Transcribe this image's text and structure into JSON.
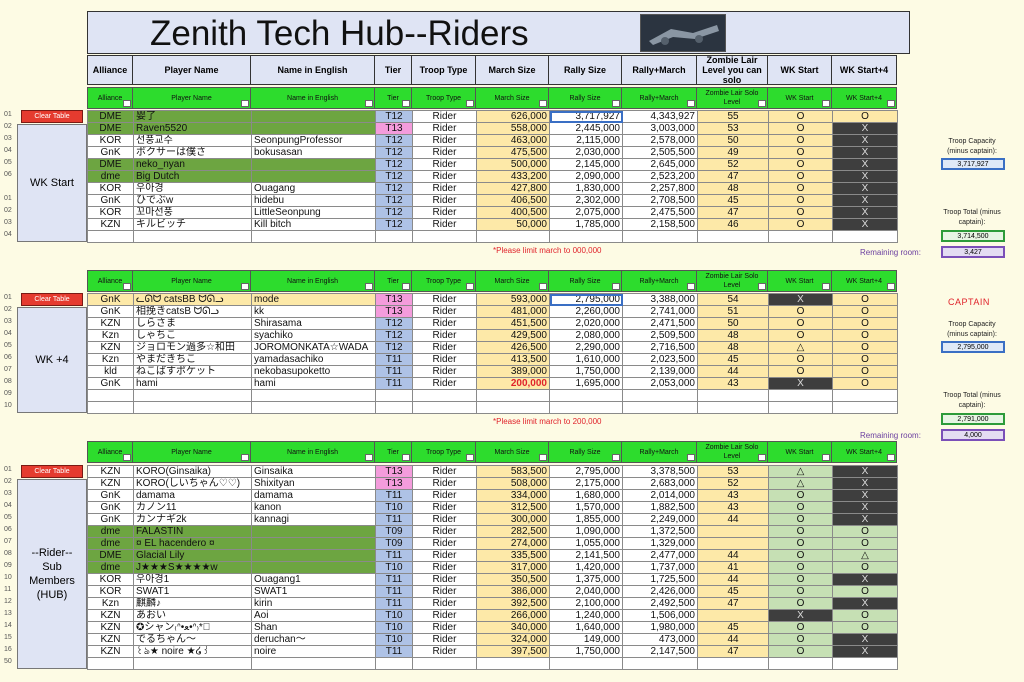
{
  "title": "Zenith Tech Hub--Riders",
  "top_headers": [
    "Alliance",
    "Player Name",
    "Name in English",
    "Tier",
    "Troop Type",
    "March Size",
    "Rally Size",
    "Rally+March",
    "Zombie Lair Level you can solo",
    "WK Start",
    "WK Start+4"
  ],
  "filter_headers": [
    "Alliance",
    "Player Name",
    "Name in English",
    "Tier",
    "Troop Type",
    "March Size",
    "Rally Size",
    "Rally+March",
    "Zombie Lair Solo Level",
    "WK Start",
    "WK Start+4"
  ],
  "clear_label": "Clear Table",
  "groups": [
    {
      "label": "WK Start",
      "row_numbers": [
        "01",
        "02",
        "03",
        "04",
        "05",
        "06",
        "",
        "01",
        "02",
        "03",
        "04"
      ],
      "rows": [
        [
          "DME",
          "婴了",
          "",
          "T12",
          "Rider",
          "626,000",
          "3,717,927",
          "4,343,927",
          "55",
          "O",
          "O"
        ],
        [
          "DME",
          "Raven5520",
          "",
          "T13",
          "Rider",
          "558,000",
          "2,445,000",
          "3,003,000",
          "53",
          "O",
          "X"
        ],
        [
          "KOR",
          "선풍교수",
          "SeonpungProfessor",
          "T12",
          "Rider",
          "463,000",
          "2,115,000",
          "2,578,000",
          "50",
          "O",
          "X"
        ],
        [
          "GnK",
          "ボクサーは僕さ",
          "bokusasan",
          "T12",
          "Rider",
          "475,500",
          "2,030,000",
          "2,505,500",
          "49",
          "O",
          "X"
        ],
        [
          "DME",
          "neko_nyan",
          "",
          "T12",
          "Rider",
          "500,000",
          "2,145,000",
          "2,645,000",
          "52",
          "O",
          "X"
        ],
        [
          "dme",
          "Big Dutch",
          "",
          "T12",
          "Rider",
          "433,200",
          "2,090,000",
          "2,523,200",
          "47",
          "O",
          "X"
        ],
        [
          "KOR",
          "우아경",
          "Ouagang",
          "T12",
          "Rider",
          "427,800",
          "1,830,000",
          "2,257,800",
          "48",
          "O",
          "X"
        ],
        [
          "GnK",
          "ひでぶw",
          "hidebu",
          "T12",
          "Rider",
          "406,500",
          "2,302,000",
          "2,708,500",
          "45",
          "O",
          "X"
        ],
        [
          "KOR",
          "꼬마선풍",
          "LittleSeonpung",
          "T12",
          "Rider",
          "400,500",
          "2,075,000",
          "2,475,500",
          "47",
          "O",
          "X"
        ],
        [
          "KZN",
          "キルビッチ",
          "Kill bitch",
          "T12",
          "Rider",
          "50,000",
          "1,785,000",
          "2,158,500",
          "46",
          "O",
          "X"
        ],
        [
          "",
          "",
          "",
          "",
          "",
          "",
          "",
          "",
          "",
          "",
          ""
        ]
      ],
      "note": "*Please limit march to 000,000",
      "troop_capacity_label": "Troop Capacity (minus captain):",
      "troop_capacity": "3,717,927",
      "troop_total_label": "Troop Total (minus captain):",
      "troop_total": "3,714,500",
      "remaining_label": "Remaining room:",
      "remaining": "3,427"
    },
    {
      "label": "WK +4",
      "row_numbers": [
        "01",
        "02",
        "03",
        "04",
        "05",
        "06",
        "07",
        "08",
        "09",
        "10"
      ],
      "rows": [
        [
          "GnK",
          "ᓚᘏᗢ catsBB ᗢᘏᓗ",
          "mode",
          "T13",
          "Rider",
          "593,000",
          "2,795,000",
          "3,388,000",
          "54",
          "X",
          "O"
        ],
        [
          "GnK",
          "相挽きcatsB ᗢᘏᓗ",
          "kk",
          "T13",
          "Rider",
          "481,000",
          "2,260,000",
          "2,741,000",
          "51",
          "O",
          "O"
        ],
        [
          "KZN",
          "しらさま",
          "Shirasama",
          "T12",
          "Rider",
          "451,500",
          "2,020,000",
          "2,471,500",
          "50",
          "O",
          "O"
        ],
        [
          "Kzn",
          "しゃちこ",
          "syachiko",
          "T12",
          "Rider",
          "429,500",
          "2,080,000",
          "2,509,500",
          "48",
          "O",
          "O"
        ],
        [
          "KZN",
          "ジョロモン過多☆和田",
          "JOROMONKATA☆WADA",
          "T12",
          "Rider",
          "426,500",
          "2,290,000",
          "2,716,500",
          "48",
          "△",
          "O"
        ],
        [
          "Kzn",
          "やまだきちこ",
          "yamadasachiko",
          "T11",
          "Rider",
          "413,500",
          "1,610,000",
          "2,023,500",
          "45",
          "O",
          "O"
        ],
        [
          "kld",
          "ねこばすポケット",
          "nekobasupoketto",
          "T11",
          "Rider",
          "389,000",
          "1,750,000",
          "2,139,000",
          "44",
          "O",
          "O"
        ],
        [
          "GnK",
          "hami",
          "hami",
          "T11",
          "Rider",
          "200,000",
          "1,695,000",
          "2,053,000",
          "43",
          "X",
          "O"
        ],
        [
          "",
          "",
          "",
          "",
          "",
          "",
          "",
          "",
          "",
          "",
          ""
        ],
        [
          "",
          "",
          "",
          "",
          "",
          "",
          "",
          "",
          "",
          "",
          ""
        ]
      ],
      "note": "*Please limit march to 200,000",
      "captain": "CAPTAIN",
      "troop_capacity_label": "Troop Capacity (minus captain):",
      "troop_capacity": "2,795,000",
      "troop_total_label": "Troop Total (minus captain):",
      "troop_total": "2,791,000",
      "remaining_label": "Remaining room:",
      "remaining": "4,000"
    },
    {
      "label": "--Rider-- Sub Members (HUB)",
      "row_numbers": [
        "01",
        "02",
        "03",
        "04",
        "05",
        "06",
        "07",
        "08",
        "09",
        "10",
        "11",
        "12",
        "13",
        "14",
        "15",
        "16",
        "50"
      ],
      "rows": [
        [
          "KZN",
          "KORO(Ginsaika)",
          "Ginsaika",
          "T13",
          "Rider",
          "583,500",
          "2,795,000",
          "3,378,500",
          "53",
          "△",
          "X"
        ],
        [
          "KZN",
          "KORO(しいちゃん♡♡)",
          "Shixityan",
          "T13",
          "Rider",
          "508,000",
          "2,175,000",
          "2,683,000",
          "52",
          "△",
          "X"
        ],
        [
          "GnK",
          "damama",
          "damama",
          "T11",
          "Rider",
          "334,000",
          "1,680,000",
          "2,014,000",
          "43",
          "O",
          "X"
        ],
        [
          "GnK",
          "カノン11",
          "kanon",
          "T10",
          "Rider",
          "312,500",
          "1,570,000",
          "1,882,500",
          "43",
          "O",
          "X"
        ],
        [
          "GnK",
          "カンナギ2k",
          "kannagi",
          "T11",
          "Rider",
          "300,000",
          "1,855,000",
          "2,249,000",
          "44",
          "O",
          "X"
        ],
        [
          "dme",
          "FALASTIN",
          "",
          "T09",
          "Rider",
          "282,500",
          "1,090,000",
          "1,372,500",
          "",
          "O",
          "O"
        ],
        [
          "dme",
          "¤ EL hacendero ¤",
          "",
          "T09",
          "Rider",
          "274,000",
          "1,055,000",
          "1,329,000",
          "",
          "O",
          "O"
        ],
        [
          "DME",
          "Glacial Lily",
          "",
          "T11",
          "Rider",
          "335,500",
          "2,141,500",
          "2,477,000",
          "44",
          "O",
          "△"
        ],
        [
          "dme",
          "J★★★S★★★★w",
          "",
          "T10",
          "Rider",
          "317,000",
          "1,420,000",
          "1,737,000",
          "41",
          "O",
          "O"
        ],
        [
          "KOR",
          "우아경1",
          "Ouagang1",
          "T11",
          "Rider",
          "350,500",
          "1,375,000",
          "1,725,500",
          "44",
          "O",
          "X"
        ],
        [
          "KOR",
          "SWAT1",
          "SWAT1",
          "T11",
          "Rider",
          "386,000",
          "2,040,000",
          "2,426,000",
          "45",
          "O",
          "O"
        ],
        [
          "Kzn",
          "麒麟♪",
          "kirin",
          "T11",
          "Rider",
          "392,500",
          "2,100,000",
          "2,492,500",
          "47",
          "O",
          "X"
        ],
        [
          "KZN",
          "あおい",
          "Aoi",
          "T10",
          "Rider",
          "266,000",
          "1,240,000",
          "1,506,000",
          "",
          "X",
          "O"
        ],
        [
          "KZN",
          "✪シャン₍ᐢ•ﻌ•ᐢ₎*ﾟ",
          "Shan",
          "T10",
          "Rider",
          "340,000",
          "1,640,000",
          "1,980,000",
          "45",
          "O",
          "O"
        ],
        [
          "KZN",
          "でるちゃん〜",
          "deruchan〜",
          "T10",
          "Rider",
          "324,000",
          "149,000",
          "473,000",
          "44",
          "O",
          "X"
        ],
        [
          "KZN",
          "꒰ঌ★ noire ★໒꒱",
          "noire",
          "T11",
          "Rider",
          "397,500",
          "1,750,000",
          "2,147,500",
          "47",
          "O",
          "X"
        ],
        [
          "",
          "",
          "",
          "",
          "",
          "",
          "",
          "",
          "",
          "",
          ""
        ]
      ]
    }
  ]
}
